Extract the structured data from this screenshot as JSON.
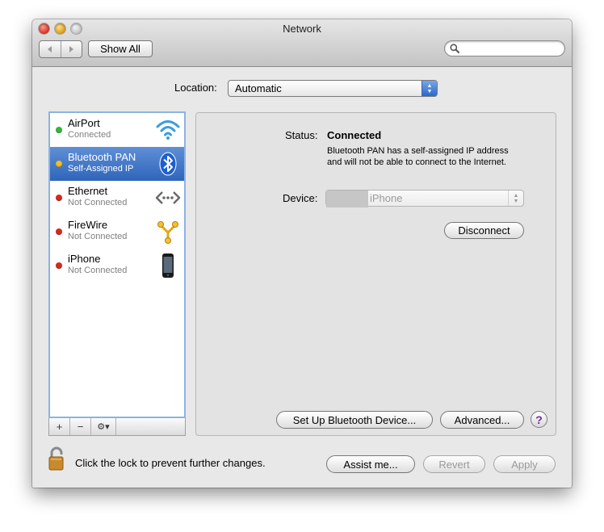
{
  "window": {
    "title": "Network"
  },
  "toolbar": {
    "back_icon": "left-triangle-icon",
    "forward_icon": "right-triangle-icon",
    "show_all_label": "Show All",
    "search": {
      "value": "",
      "placeholder": ""
    }
  },
  "location": {
    "label": "Location:",
    "value": "Automatic"
  },
  "services": [
    {
      "name": "AirPort",
      "status": "Connected",
      "status_color": "#36b63a",
      "icon": "wifi-icon"
    },
    {
      "name": "Bluetooth PAN",
      "status": "Self-Assigned IP",
      "status_color": "#f0c020",
      "icon": "bluetooth-icon",
      "selected": true
    },
    {
      "name": "Ethernet",
      "status": "Not Connected",
      "status_color": "#d8281c",
      "icon": "ethernet-icon"
    },
    {
      "name": "FireWire",
      "status": "Not Connected",
      "status_color": "#d8281c",
      "icon": "firewire-icon"
    },
    {
      "name": "iPhone",
      "status": "Not Connected",
      "status_color": "#d8281c",
      "icon": "iphone-icon"
    }
  ],
  "list_toolbar": {
    "add_label": "+",
    "remove_label": "−",
    "action_label": "⚙▾"
  },
  "detail": {
    "status_label": "Status:",
    "status_value": "Connected",
    "status_description": "Bluetooth PAN has a self-assigned IP address and will not be able to connect to the Internet.",
    "device_label": "Device:",
    "device_value": "iPhone",
    "disconnect_label": "Disconnect",
    "setup_label": "Set Up Bluetooth Device...",
    "advanced_label": "Advanced...",
    "help_label": "?"
  },
  "footer": {
    "lock_text": "Click the lock to prevent further changes.",
    "assist_label": "Assist me...",
    "revert_label": "Revert",
    "apply_label": "Apply"
  },
  "colors": {
    "selection": "#3a6fc0",
    "list_border": "#8db2e3",
    "help_glyph": "#6b2fa0"
  }
}
